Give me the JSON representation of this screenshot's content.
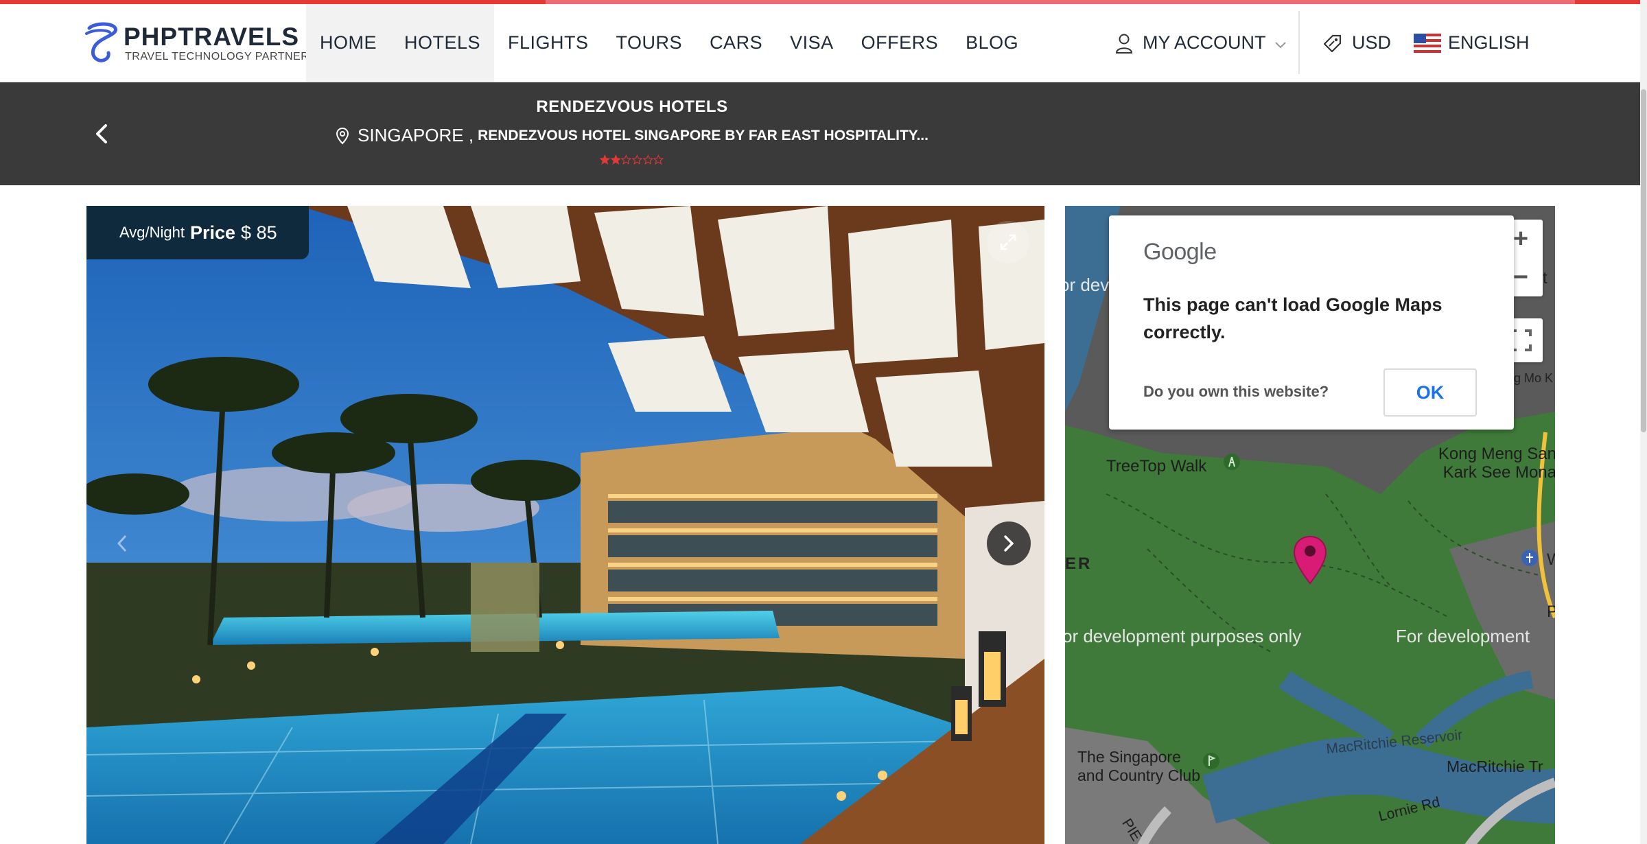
{
  "brand": {
    "name": "PHPTRAVELS",
    "tagline": "TRAVEL TECHNOLOGY PARTNER",
    "accent": "#e53935",
    "logo_color": "#3b5bdb"
  },
  "nav": {
    "items": [
      {
        "label": "HOME"
      },
      {
        "label": "HOTELS"
      },
      {
        "label": "FLIGHTS"
      },
      {
        "label": "TOURS"
      },
      {
        "label": "CARS"
      },
      {
        "label": "VISA"
      },
      {
        "label": "OFFERS"
      },
      {
        "label": "BLOG"
      }
    ],
    "account_label": "MY ACCOUNT",
    "currency_label": "USD",
    "language_label": "ENGLISH"
  },
  "hotel": {
    "name": "RENDEZVOUS HOTELS",
    "city": "SINGAPORE ,",
    "address": "RENDEZVOUS HOTEL SINGAPORE BY FAR EAST HOSPITALITY...",
    "rating": 2,
    "rating_max": 6,
    "star_color": "#e53935"
  },
  "gallery": {
    "avg_night_label": "Avg/Night",
    "price_word": "Price",
    "price_value": "$ 85"
  },
  "map": {
    "dialog": {
      "brand": "Google",
      "message": "This page can't load Google Maps correctly.",
      "own_question": "Do you own this website?",
      "ok_label": "OK"
    },
    "zoom_in": "+",
    "zoom_out": "−",
    "watermark_1": "or development purposes only",
    "watermark_2": "For development",
    "watermark_3": "or dev",
    "place_treetop": "TreeTop Walk",
    "place_kong_1": "Kong Meng San",
    "place_kong_2": "Kark See Mona",
    "place_club_1": "The Singapore",
    "place_club_2": "and Country Club",
    "place_macritchie_res": "MacRitchie Reservoir",
    "place_macritchie_tr": "MacRitchie Tr",
    "place_lornie": "Lornie Rd",
    "place_pie": "PIE",
    "place_er": "ER",
    "place_mo": "g Mo K",
    "place_edge_p": "P",
    "place_edge_t": "t",
    "place_edge_w": "W",
    "marker_color": "#d81b74"
  }
}
